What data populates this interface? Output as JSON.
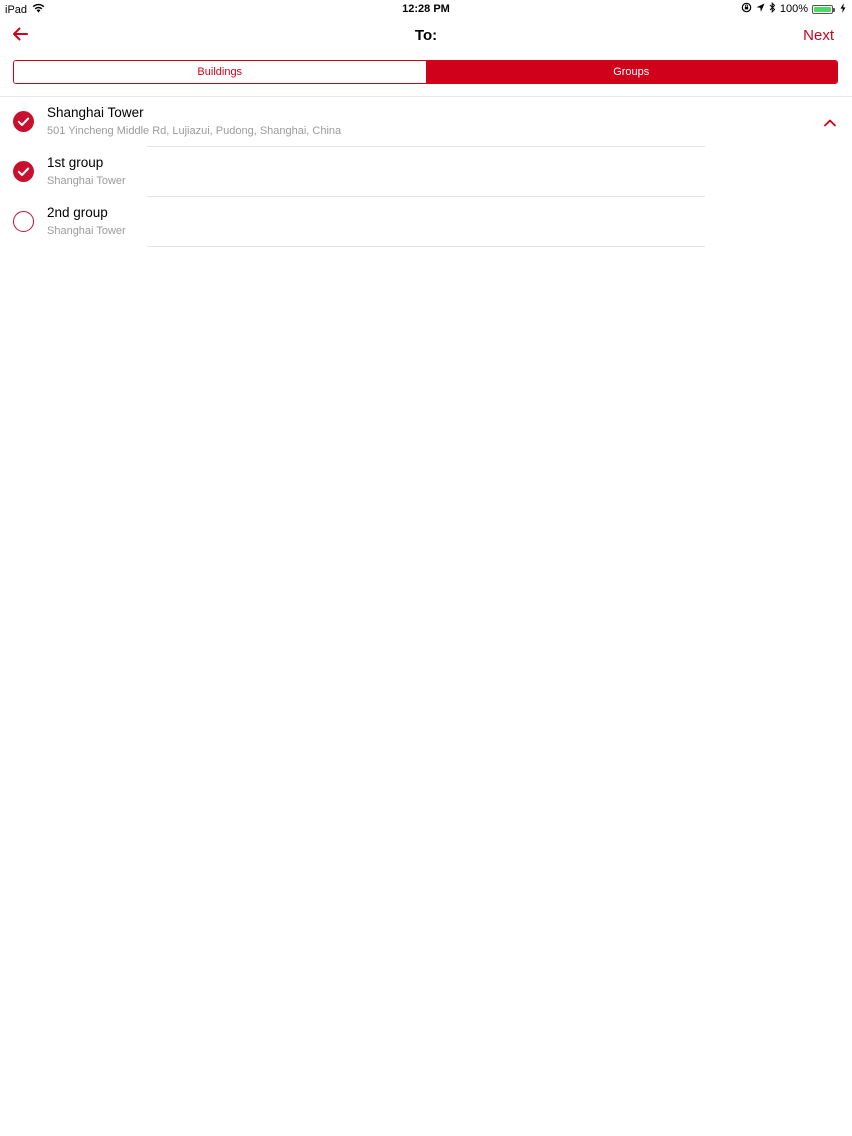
{
  "status_bar": {
    "device": "iPad",
    "time": "12:28 PM",
    "battery": "100%",
    "battery_level": 1.0,
    "icons": [
      "wifi-icon",
      "orientation-lock-icon",
      "location-icon",
      "bluetooth-icon",
      "battery-icon",
      "charging-icon"
    ]
  },
  "nav": {
    "title": "To:",
    "next_label": "Next",
    "back_icon": "back-arrow-icon"
  },
  "segments": [
    {
      "label": "Buildings",
      "selected": false
    },
    {
      "label": "Groups",
      "selected": true
    }
  ],
  "items": [
    {
      "title": "Shanghai Tower",
      "subtitle": "501 Yincheng Middle Rd, Lujiazui, Pudong, Shanghai, China",
      "checked": true,
      "expanded": true
    },
    {
      "title": "1st group",
      "subtitle": "Shanghai Tower",
      "checked": true
    },
    {
      "title": "2nd group",
      "subtitle": "Shanghai Tower",
      "checked": false
    }
  ],
  "colors": {
    "accent": "#d0021b",
    "check": "#c8102e",
    "subtitle": "#9b9b9b",
    "battery": "#4cd964"
  }
}
